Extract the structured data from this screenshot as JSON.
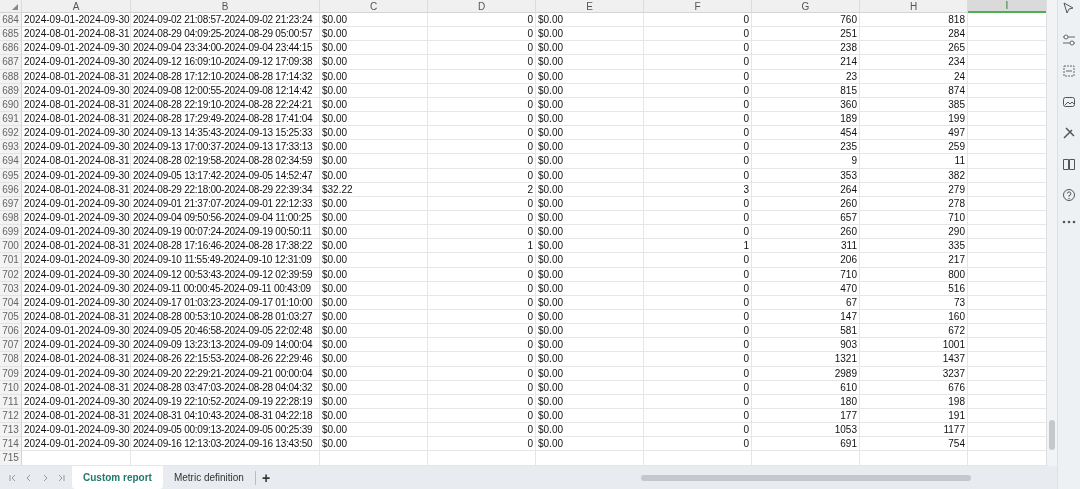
{
  "columns": [
    {
      "letter": "A",
      "kind": "text",
      "selected": false
    },
    {
      "letter": "B",
      "kind": "text",
      "selected": false
    },
    {
      "letter": "C",
      "kind": "text",
      "selected": false
    },
    {
      "letter": "D",
      "kind": "number",
      "selected": false
    },
    {
      "letter": "E",
      "kind": "text",
      "selected": false
    },
    {
      "letter": "F",
      "kind": "number",
      "selected": false
    },
    {
      "letter": "G",
      "kind": "number",
      "selected": false
    },
    {
      "letter": "H",
      "kind": "number",
      "selected": false
    },
    {
      "letter": "I",
      "kind": "text",
      "selected": true
    }
  ],
  "rows": [
    {
      "number": "684",
      "cells": [
        "2024-09-01-2024-09-30",
        "2024-09-02 21:08:57-2024-09-02 21:23:24",
        "$0.00",
        "0",
        "$0.00",
        "0",
        "760",
        "818"
      ]
    },
    {
      "number": "685",
      "cells": [
        "2024-08-01-2024-08-31",
        "2024-08-29 04:09:25-2024-08-29 05:00:57",
        "$0.00",
        "0",
        "$0.00",
        "0",
        "251",
        "284"
      ]
    },
    {
      "number": "686",
      "cells": [
        "2024-09-01-2024-09-30",
        "2024-09-04 23:34:00-2024-09-04 23:44:15",
        "$0.00",
        "0",
        "$0.00",
        "0",
        "238",
        "265"
      ]
    },
    {
      "number": "687",
      "cells": [
        "2024-09-01-2024-09-30",
        "2024-09-12 16:09:10-2024-09-12 17:09:38",
        "$0.00",
        "0",
        "$0.00",
        "0",
        "214",
        "234"
      ]
    },
    {
      "number": "688",
      "cells": [
        "2024-08-01-2024-08-31",
        "2024-08-28 17:12:10-2024-08-28 17:14:32",
        "$0.00",
        "0",
        "$0.00",
        "0",
        "23",
        "24"
      ]
    },
    {
      "number": "689",
      "cells": [
        "2024-09-01-2024-09-30",
        "2024-09-08 12:00:55-2024-09-08 12:14:42",
        "$0.00",
        "0",
        "$0.00",
        "0",
        "815",
        "874"
      ]
    },
    {
      "number": "690",
      "cells": [
        "2024-08-01-2024-08-31",
        "2024-08-28 22:19:10-2024-08-28 22:24:21",
        "$0.00",
        "0",
        "$0.00",
        "0",
        "360",
        "385"
      ]
    },
    {
      "number": "691",
      "cells": [
        "2024-08-01-2024-08-31",
        "2024-08-28 17:29:49-2024-08-28 17:41:04",
        "$0.00",
        "0",
        "$0.00",
        "0",
        "189",
        "199"
      ]
    },
    {
      "number": "692",
      "cells": [
        "2024-09-01-2024-09-30",
        "2024-09-13 14:35:43-2024-09-13 15:25:33",
        "$0.00",
        "0",
        "$0.00",
        "0",
        "454",
        "497"
      ]
    },
    {
      "number": "693",
      "cells": [
        "2024-09-01-2024-09-30",
        "2024-09-13 17:00:37-2024-09-13 17:33:13",
        "$0.00",
        "0",
        "$0.00",
        "0",
        "235",
        "259"
      ]
    },
    {
      "number": "694",
      "cells": [
        "2024-08-01-2024-08-31",
        "2024-08-28 02:19:58-2024-08-28 02:34:59",
        "$0.00",
        "0",
        "$0.00",
        "0",
        "9",
        "11"
      ]
    },
    {
      "number": "695",
      "cells": [
        "2024-09-01-2024-09-30",
        "2024-09-05 13:17:42-2024-09-05 14:52:47",
        "$0.00",
        "0",
        "$0.00",
        "0",
        "353",
        "382"
      ]
    },
    {
      "number": "696",
      "cells": [
        "2024-08-01-2024-08-31",
        "2024-08-29 22:18:00-2024-08-29 22:39:34",
        "$32.22",
        "2",
        "$0.00",
        "3",
        "264",
        "279"
      ]
    },
    {
      "number": "697",
      "cells": [
        "2024-09-01-2024-09-30",
        "2024-09-01 21:37:07-2024-09-01 22:12:33",
        "$0.00",
        "0",
        "$0.00",
        "0",
        "260",
        "278"
      ]
    },
    {
      "number": "698",
      "cells": [
        "2024-09-01-2024-09-30",
        "2024-09-04 09:50:56-2024-09-04 11:00:25",
        "$0.00",
        "0",
        "$0.00",
        "0",
        "657",
        "710"
      ]
    },
    {
      "number": "699",
      "cells": [
        "2024-09-01-2024-09-30",
        "2024-09-19 00:07:24-2024-09-19 00:50:11",
        "$0.00",
        "0",
        "$0.00",
        "0",
        "260",
        "290"
      ]
    },
    {
      "number": "700",
      "cells": [
        "2024-08-01-2024-08-31",
        "2024-08-28 17:16:46-2024-08-28 17:38:22",
        "$0.00",
        "1",
        "$0.00",
        "1",
        "311",
        "335"
      ]
    },
    {
      "number": "701",
      "cells": [
        "2024-09-01-2024-09-30",
        "2024-09-10 11:55:49-2024-09-10 12:31:09",
        "$0.00",
        "0",
        "$0.00",
        "0",
        "206",
        "217"
      ]
    },
    {
      "number": "702",
      "cells": [
        "2024-09-01-2024-09-30",
        "2024-09-12 00:53:43-2024-09-12 02:39:59",
        "$0.00",
        "0",
        "$0.00",
        "0",
        "710",
        "800"
      ]
    },
    {
      "number": "703",
      "cells": [
        "2024-09-01-2024-09-30",
        "2024-09-11 00:00:45-2024-09-11 00:43:09",
        "$0.00",
        "0",
        "$0.00",
        "0",
        "470",
        "516"
      ]
    },
    {
      "number": "704",
      "cells": [
        "2024-09-01-2024-09-30",
        "2024-09-17 01:03:23-2024-09-17 01:10:00",
        "$0.00",
        "0",
        "$0.00",
        "0",
        "67",
        "73"
      ]
    },
    {
      "number": "705",
      "cells": [
        "2024-08-01-2024-08-31",
        "2024-08-28 00:53:10-2024-08-28 01:03:27",
        "$0.00",
        "0",
        "$0.00",
        "0",
        "147",
        "160"
      ]
    },
    {
      "number": "706",
      "cells": [
        "2024-09-01-2024-09-30",
        "2024-09-05 20:46:58-2024-09-05 22:02:48",
        "$0.00",
        "0",
        "$0.00",
        "0",
        "581",
        "672"
      ]
    },
    {
      "number": "707",
      "cells": [
        "2024-09-01-2024-09-30",
        "2024-09-09 13:23:13-2024-09-09 14:00:04",
        "$0.00",
        "0",
        "$0.00",
        "0",
        "903",
        "1001"
      ]
    },
    {
      "number": "708",
      "cells": [
        "2024-08-01-2024-08-31",
        "2024-08-26 22:15:53-2024-08-26 22:29:46",
        "$0.00",
        "0",
        "$0.00",
        "0",
        "1321",
        "1437"
      ]
    },
    {
      "number": "709",
      "cells": [
        "2024-09-01-2024-09-30",
        "2024-09-20 22:29:21-2024-09-21 00:00:04",
        "$0.00",
        "0",
        "$0.00",
        "0",
        "2989",
        "3237"
      ]
    },
    {
      "number": "710",
      "cells": [
        "2024-08-01-2024-08-31",
        "2024-08-28 03:47:03-2024-08-28 04:04:32",
        "$0.00",
        "0",
        "$0.00",
        "0",
        "610",
        "676"
      ]
    },
    {
      "number": "711",
      "cells": [
        "2024-09-01-2024-09-30",
        "2024-09-19 22:10:52-2024-09-19 22:28:19",
        "$0.00",
        "0",
        "$0.00",
        "0",
        "180",
        "198"
      ]
    },
    {
      "number": "712",
      "cells": [
        "2024-08-01-2024-08-31",
        "2024-08-31 04:10:43-2024-08-31 04:22:18",
        "$0.00",
        "0",
        "$0.00",
        "0",
        "177",
        "191"
      ]
    },
    {
      "number": "713",
      "cells": [
        "2024-09-01-2024-09-30",
        "2024-09-05 00:09:13-2024-09-05 00:25:39",
        "$0.00",
        "0",
        "$0.00",
        "0",
        "1053",
        "1177"
      ]
    },
    {
      "number": "714",
      "cells": [
        "2024-09-01-2024-09-30",
        "2024-09-16 12:13:03-2024-09-16 13:43:50",
        "$0.00",
        "0",
        "$0.00",
        "0",
        "691",
        "754"
      ]
    }
  ],
  "empty_rows": [
    "715"
  ],
  "sheet_tabs": [
    {
      "label": "Custom report",
      "selected": true
    },
    {
      "label": "Metric definition",
      "selected": false
    }
  ],
  "add_sheet": "+"
}
